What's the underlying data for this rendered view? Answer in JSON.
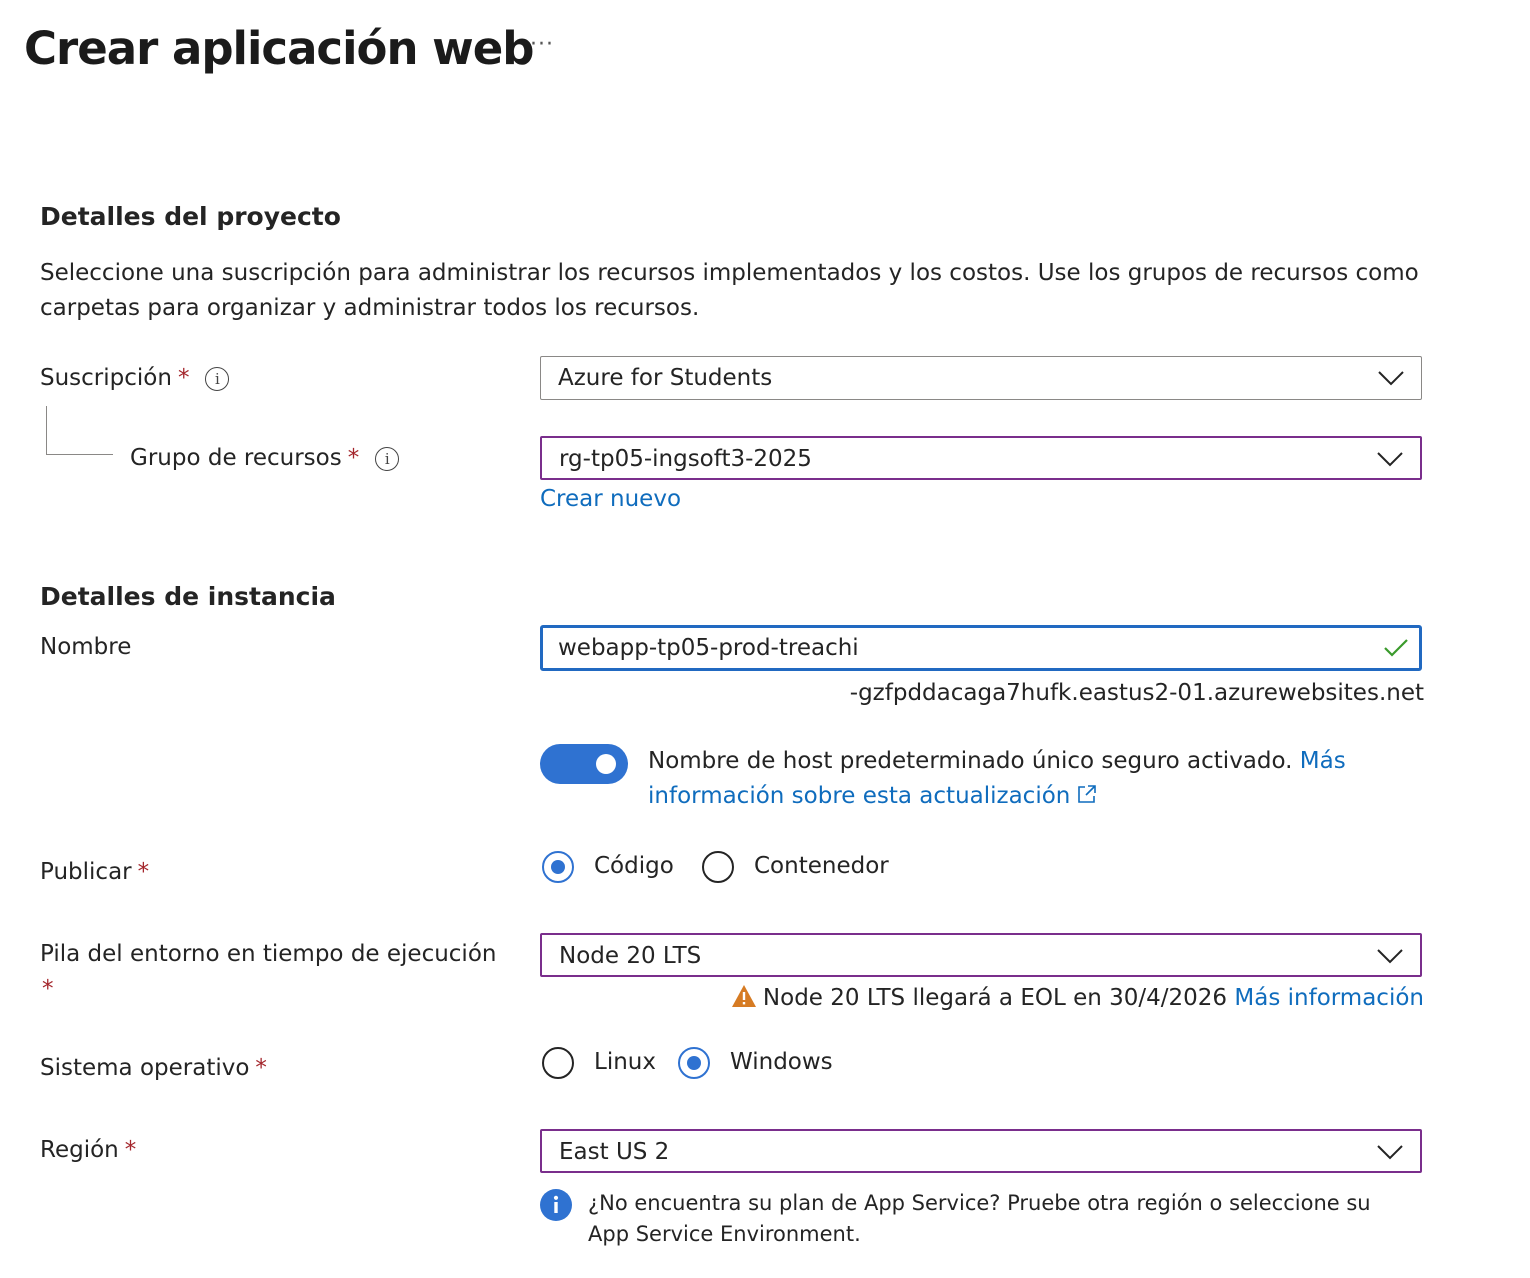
{
  "header": {
    "title": "Crear aplicación web",
    "more_label": "···"
  },
  "project": {
    "heading": "Detalles del proyecto",
    "description": "Seleccione una suscripción para administrar los recursos implementados y los costos. Use los grupos de recursos como carpetas para organizar y administrar todos los recursos.",
    "subscription": {
      "label": "Suscripción",
      "required": "*",
      "info": "i",
      "value": "Azure for Students"
    },
    "resource_group": {
      "label": "Grupo de recursos",
      "required": "*",
      "info": "i",
      "value": "rg-tp05-ingsoft3-2025",
      "create_new": "Crear nuevo"
    }
  },
  "instance": {
    "heading": "Detalles de instancia",
    "name": {
      "label": "Nombre",
      "value": "webapp-tp05-prod-treachi",
      "domain_suffix": "-gzfpddacaga7hufk.eastus2-01.azurewebsites.net"
    },
    "secure_hostname": {
      "text": "Nombre de host predeterminado único seguro activado.",
      "link": "Más información sobre esta actualización",
      "enabled": true
    },
    "publish": {
      "label": "Publicar",
      "required": "*",
      "options": [
        "Código",
        "Contenedor"
      ],
      "selected": "Código"
    },
    "runtime": {
      "label": "Pila del entorno en tiempo de ejecución",
      "required": "*",
      "value": "Node 20 LTS",
      "warning": "Node 20 LTS llegará a EOL en 30/4/2026",
      "warning_link": "Más información"
    },
    "os": {
      "label": "Sistema operativo",
      "required": "*",
      "options": [
        "Linux",
        "Windows"
      ],
      "selected": "Windows"
    },
    "region": {
      "label": "Región",
      "required": "*",
      "value": "East US 2",
      "note": "¿No encuentra su plan de App Service? Pruebe otra región o seleccione su App Service Environment."
    }
  },
  "colors": {
    "link": "#0f6cbd",
    "accent": "#2f72d1",
    "required": "#a4262c",
    "focus_border": "#2169c1",
    "purple_border": "#7a2e8c",
    "success": "#3a9a2c",
    "warning": "#d67b23"
  }
}
